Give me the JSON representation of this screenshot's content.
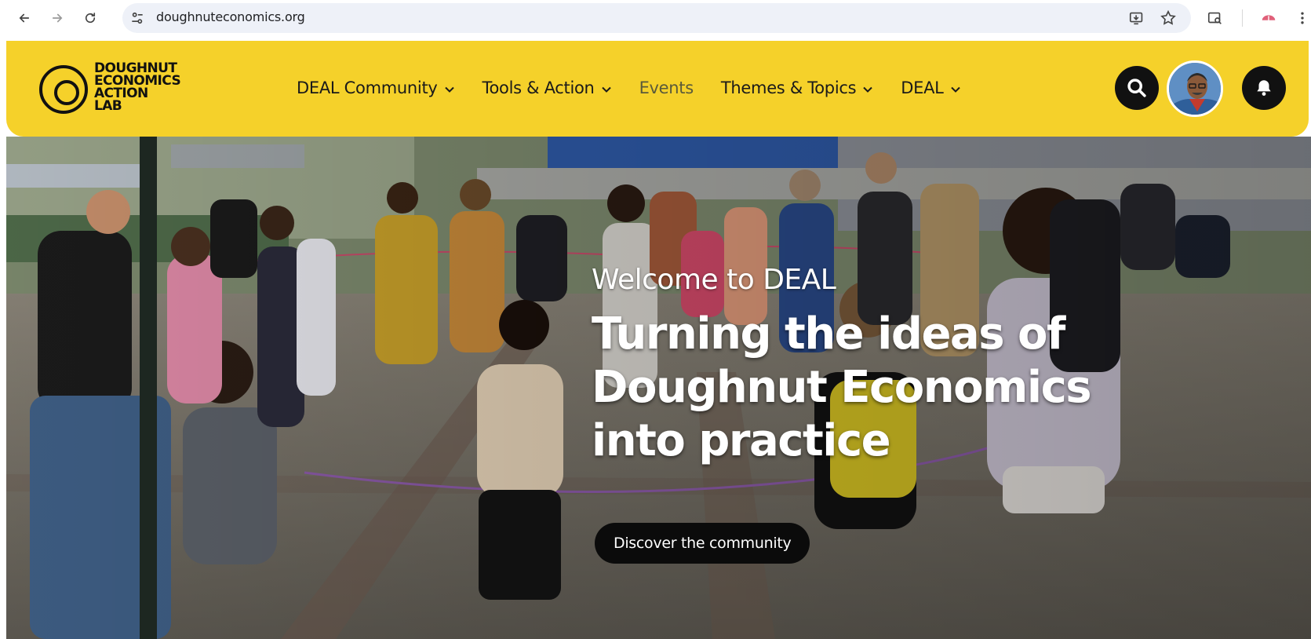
{
  "browser": {
    "url": "doughnuteconomics.org",
    "icons": {
      "back": "back-arrow-icon",
      "forward": "forward-arrow-icon",
      "reload": "reload-icon",
      "site_info": "tune-icon",
      "install": "install-app-icon",
      "bookmark": "star-icon",
      "lens": "search-page-icon",
      "profile": "profile-icon",
      "menu": "kebab-menu-icon"
    }
  },
  "site": {
    "logo_lines": [
      "DOUGHNUT",
      "ECONOMICS",
      "ACTION",
      "LAB"
    ],
    "nav": [
      {
        "label": "DEAL Community",
        "dropdown": true
      },
      {
        "label": "Tools & Action",
        "dropdown": true
      },
      {
        "label": "Events",
        "dropdown": false
      },
      {
        "label": "Themes & Topics",
        "dropdown": true
      },
      {
        "label": "DEAL",
        "dropdown": true
      }
    ],
    "header_icons": {
      "search": "search-icon",
      "avatar": "user-avatar",
      "notifications": "bell-icon"
    },
    "colors": {
      "brand_yellow": "#f5d12a",
      "dark": "#111111"
    }
  },
  "hero": {
    "kicker": "Welcome to DEAL",
    "title": "Turning the ideas of Doughnut Economics into practice",
    "cta": "Discover the community"
  }
}
